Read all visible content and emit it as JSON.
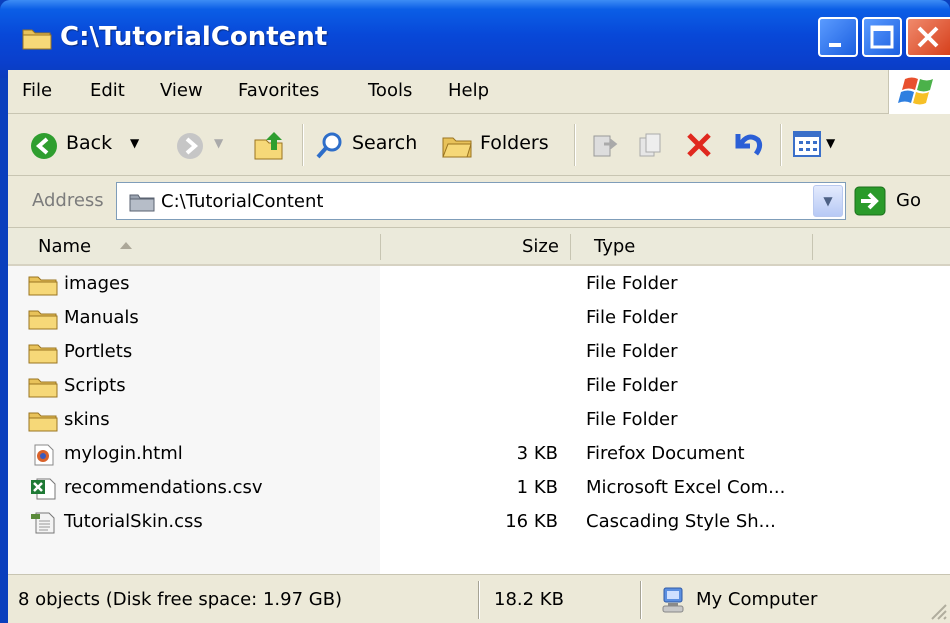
{
  "window": {
    "title": "C:\\TutorialContent"
  },
  "menu": {
    "items": [
      "File",
      "Edit",
      "View",
      "Favorites",
      "Tools",
      "Help"
    ]
  },
  "toolbar": {
    "back_label": "Back",
    "search_label": "Search",
    "folders_label": "Folders"
  },
  "address": {
    "label": "Address",
    "value": "C:\\TutorialContent",
    "go_label": "Go"
  },
  "columns": {
    "name": "Name",
    "size": "Size",
    "type": "Type"
  },
  "files": [
    {
      "name": "images",
      "size": "",
      "type": "File Folder",
      "icon": "folder-icon"
    },
    {
      "name": "Manuals",
      "size": "",
      "type": "File Folder",
      "icon": "folder-icon"
    },
    {
      "name": "Portlets",
      "size": "",
      "type": "File Folder",
      "icon": "folder-icon"
    },
    {
      "name": "Scripts",
      "size": "",
      "type": "File Folder",
      "icon": "folder-icon"
    },
    {
      "name": "skins",
      "size": "",
      "type": "File Folder",
      "icon": "folder-icon"
    },
    {
      "name": "mylogin.html",
      "size": "3 KB",
      "type": "Firefox Document",
      "icon": "html-document-icon"
    },
    {
      "name": "recommendations.csv",
      "size": "1 KB",
      "type": "Microsoft Excel Com...",
      "icon": "excel-document-icon"
    },
    {
      "name": "TutorialSkin.css",
      "size": "16 KB",
      "type": "Cascading Style Sh...",
      "icon": "css-document-icon"
    }
  ],
  "status": {
    "objects": "8 objects (Disk free space: 1.97 GB)",
    "total_size": "18.2 KB",
    "location": "My Computer"
  },
  "colors": {
    "titlebar": "#0a3fcc",
    "chrome": "#ece9d8",
    "close": "#d6401c",
    "go": "#2a9a2a"
  }
}
